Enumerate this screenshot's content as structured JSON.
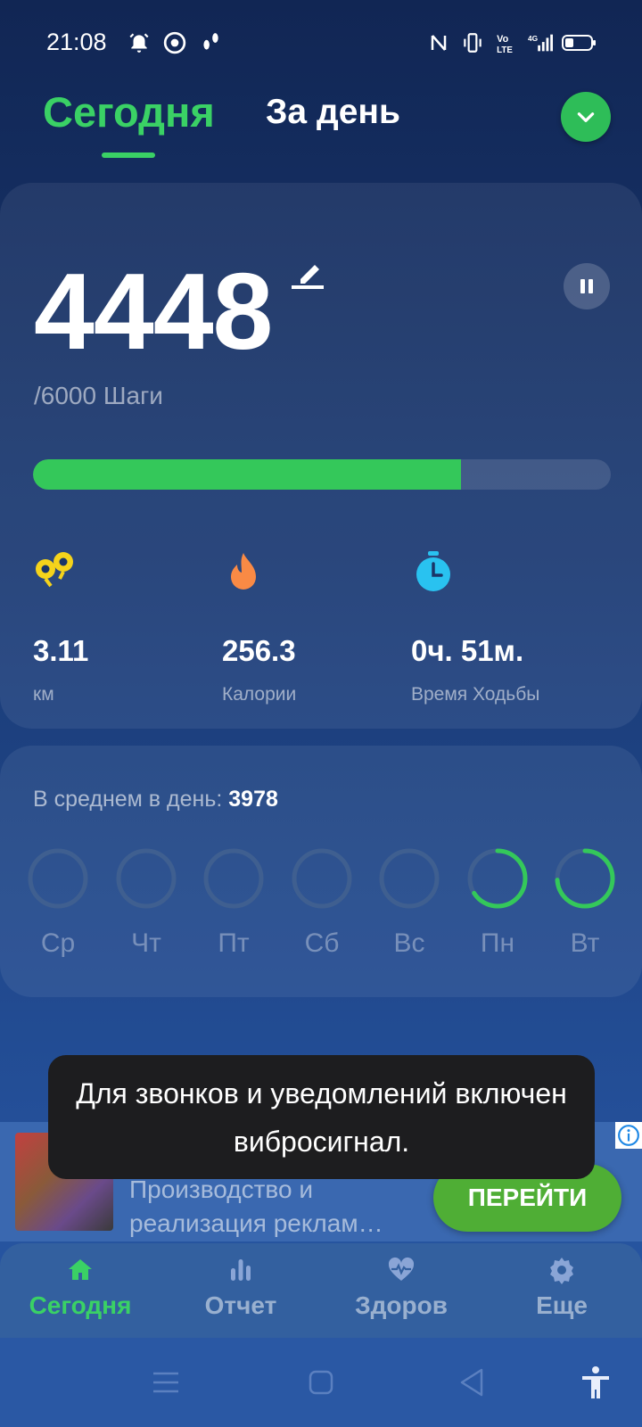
{
  "status_bar": {
    "time": "21:08",
    "left_icons": [
      "alarm-icon",
      "chrome-icon",
      "footsteps-icon"
    ],
    "right_icons": [
      "nfc-icon",
      "vibrate-icon",
      "volte-icon",
      "signal-4g-icon",
      "battery-icon"
    ]
  },
  "tabs": {
    "today": "Сегодня",
    "day": "За день"
  },
  "steps": {
    "value": "4448",
    "goal_text": "/6000 Шаги",
    "progress_fraction": 0.741
  },
  "stats": [
    {
      "icon": "distance-pin-icon",
      "value": "3.11",
      "label": "км",
      "color": "#f5d31b"
    },
    {
      "icon": "fire-icon",
      "value": "256.3",
      "label": "Калории",
      "color": "#f98a45"
    },
    {
      "icon": "stopwatch-icon",
      "value": "0ч. 51м.",
      "label": "Время Ходьбы",
      "color": "#29c2f0"
    }
  ],
  "average": {
    "label": "В среднем в день: ",
    "value": "3978"
  },
  "week": [
    {
      "label": "Ср",
      "fraction": 0
    },
    {
      "label": "Чт",
      "fraction": 0
    },
    {
      "label": "Пт",
      "fraction": 0
    },
    {
      "label": "Сб",
      "fraction": 0
    },
    {
      "label": "Вс",
      "fraction": 0
    },
    {
      "label": "Пн",
      "fraction": 0.66
    },
    {
      "label": "Вт",
      "fraction": 0.74
    }
  ],
  "toast": {
    "text": "Для звонков и уведомлений включен вибросигнал."
  },
  "ad": {
    "text": "Производство и реализация реклам…",
    "cta": "ПЕРЕЙТИ"
  },
  "bottom_nav": [
    {
      "icon": "home-icon",
      "label": "Сегодня",
      "active": true
    },
    {
      "icon": "bar-chart-icon",
      "label": "Отчет",
      "active": false
    },
    {
      "icon": "heart-pulse-icon",
      "label": "Здоров",
      "active": false
    },
    {
      "icon": "gear-icon",
      "label": "Еще",
      "active": false
    }
  ],
  "colors": {
    "accent_green": "#3ad165",
    "progress_green": "#34c85a",
    "ring_track": "#3f5f90",
    "ad_button": "#4fae35"
  }
}
